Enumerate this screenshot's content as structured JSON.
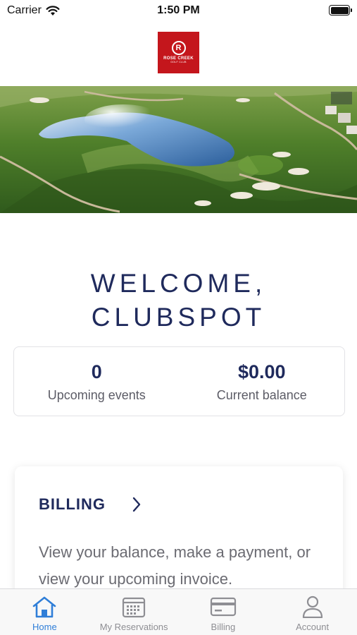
{
  "status_bar": {
    "carrier": "Carrier",
    "time": "1:50 PM"
  },
  "header": {
    "logo_name": "ROSE CREEK",
    "logo_sub": "GOLF CLUB",
    "logo_mark": "R"
  },
  "welcome": {
    "line1": "WELCOME,",
    "line2": "CLUBSPOT"
  },
  "stats": [
    {
      "value": "0",
      "label": "Upcoming events"
    },
    {
      "value": "$0.00",
      "label": "Current balance"
    }
  ],
  "billing_card": {
    "title": "BILLING",
    "description": "View your balance, make a payment, or view your upcoming invoice."
  },
  "tabs": [
    {
      "label": "Home",
      "icon": "home-icon",
      "active": true
    },
    {
      "label": "My Reservations",
      "icon": "calendar-icon",
      "active": false
    },
    {
      "label": "Billing",
      "icon": "credit-card-icon",
      "active": false
    },
    {
      "label": "Account",
      "icon": "person-icon",
      "active": false
    }
  ],
  "colors": {
    "brand_navy": "#1f2a5c",
    "active_tab": "#2f7ed8",
    "inactive_tab": "#8e8e93",
    "logo_red": "#c4161c"
  }
}
